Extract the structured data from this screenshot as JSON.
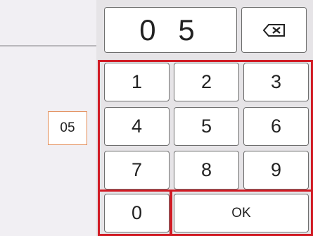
{
  "left_panel": {
    "field_value": "05"
  },
  "numpad": {
    "display_value": "0 5",
    "backspace_icon": "backspace-icon",
    "keys": {
      "k1": "1",
      "k2": "2",
      "k3": "3",
      "k4": "4",
      "k5": "5",
      "k6": "6",
      "k7": "7",
      "k8": "8",
      "k9": "9",
      "k0": "0"
    },
    "ok_label": "OK"
  },
  "colors": {
    "highlight_frame": "#d11b24",
    "field_border": "#e38b55"
  }
}
